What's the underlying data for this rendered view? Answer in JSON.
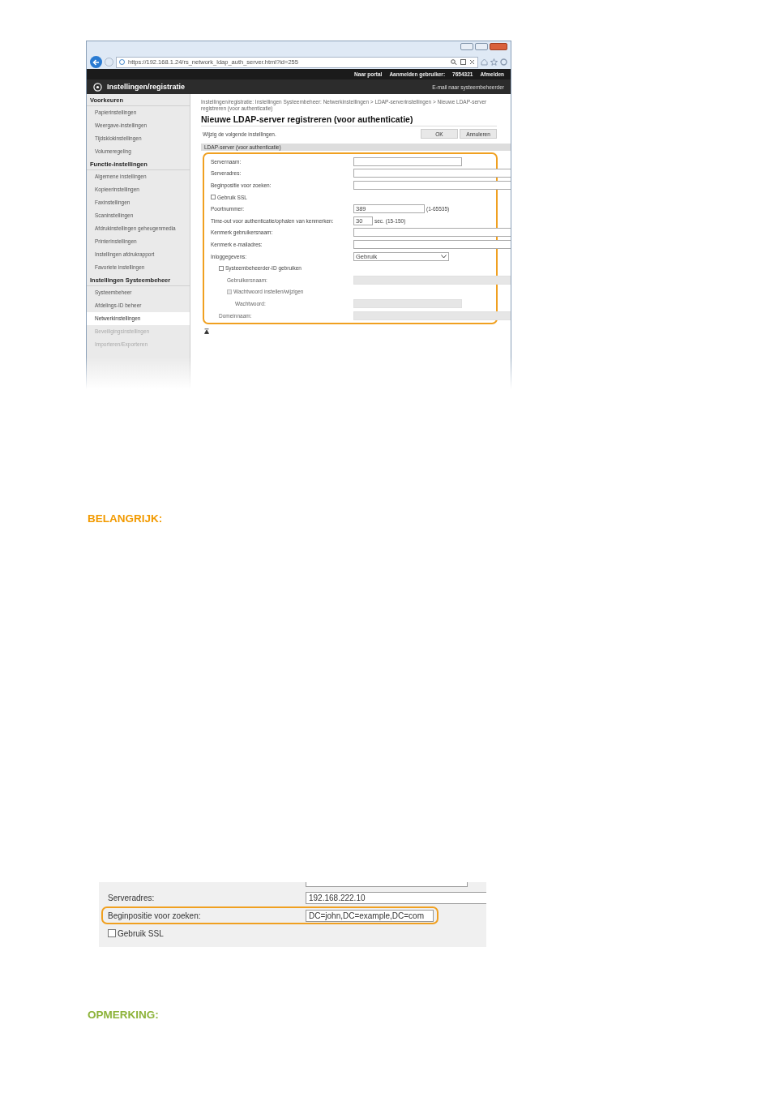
{
  "browser": {
    "url": "https://192.168.1.24/rs_network_ldap_auth_server.html?id=255"
  },
  "header": {
    "links": [
      "Naar portal",
      "Aanmelden gebruiker:",
      "7654321",
      "Afmelden"
    ],
    "app_title": "Instellingen/registratie",
    "mail_link": "E-mail naar systeembeheerder"
  },
  "sidebar": {
    "groups": [
      {
        "title": "Voorkeuren",
        "items": [
          {
            "label": "Papierinstellingen",
            "selected": false,
            "disabled": false
          },
          {
            "label": "Weergave-instellingen",
            "selected": false,
            "disabled": false
          },
          {
            "label": "Tijdsklokinstellingen",
            "selected": false,
            "disabled": false
          },
          {
            "label": "Volumeregeling",
            "selected": false,
            "disabled": false
          }
        ]
      },
      {
        "title": "Functie-instellingen",
        "items": [
          {
            "label": "Algemene instellingen",
            "selected": false,
            "disabled": false
          },
          {
            "label": "Kopieerinstellingen",
            "selected": false,
            "disabled": false
          },
          {
            "label": "Faxinstellingen",
            "selected": false,
            "disabled": false
          },
          {
            "label": "Scaninstellingen",
            "selected": false,
            "disabled": false
          },
          {
            "label": "Afdrukinstellingen geheugenmedia",
            "selected": false,
            "disabled": false
          },
          {
            "label": "Printerinstellingen",
            "selected": false,
            "disabled": false
          },
          {
            "label": "Instellingen afdrukrapport",
            "selected": false,
            "disabled": false
          },
          {
            "label": "Favoriete instellingen",
            "selected": false,
            "disabled": false
          }
        ]
      },
      {
        "title": "Instellingen Systeembeheer",
        "items": [
          {
            "label": "Systeembeheer",
            "selected": false,
            "disabled": false
          },
          {
            "label": "Afdelings-ID beheer",
            "selected": false,
            "disabled": false
          },
          {
            "label": "Netwerkinstellingen",
            "selected": true,
            "disabled": false
          },
          {
            "label": "Beveiligingsinstellingen",
            "selected": false,
            "disabled": true
          },
          {
            "label": "Importeren/Exporteren",
            "selected": false,
            "disabled": true
          }
        ]
      }
    ]
  },
  "main": {
    "breadcrumb": "Instellingen/registratie: Instellingen Systeembeheer: Netwerkinstellingen > LDAP-serverinstellingen > Nieuwe LDAP-server registreren (voor authenticatie)",
    "title": "Nieuwe LDAP-server registreren (voor authenticatie)",
    "intro": "Wijzig de volgende instellingen.",
    "buttons": [
      "OK",
      "Annuleren"
    ],
    "section_title": "LDAP-server (voor authenticatie)",
    "rows": [
      {
        "kind": "short-text",
        "label": "Servernaam:",
        "disabled": false
      },
      {
        "kind": "text",
        "label": "Serveradres:",
        "disabled": false
      },
      {
        "kind": "text",
        "label": "Beginpositie voor zoeken:",
        "disabled": false
      },
      {
        "kind": "checkbox",
        "label": "Gebruik SSL",
        "checked": false,
        "disabled": false
      },
      {
        "kind": "number",
        "label": "Poortnummer:",
        "value": "389",
        "hint": "(1-65535)",
        "disabled": false
      },
      {
        "kind": "tiny-number",
        "label": "Time-out voor authenticatie/ophalen van kenmerken:",
        "value": "30",
        "hint": "sec. (15-150)",
        "disabled": false
      },
      {
        "kind": "text",
        "label": "Kenmerk gebruikersnaam:",
        "disabled": false
      },
      {
        "kind": "text",
        "label": "Kenmerk e-mailadres:",
        "disabled": false
      },
      {
        "kind": "select",
        "label": "Inloggegevens:",
        "value": "Gebruik",
        "disabled": false,
        "children": [
          {
            "kind": "checkbox",
            "label": "Systeembeheerder-ID gebruiken",
            "checked": false,
            "disabled": false,
            "children": [
              {
                "kind": "text",
                "label": "Gebruikersnaam:",
                "disabled": true
              },
              {
                "kind": "checkbox",
                "label": "Wachtwoord instellen/wijzigen",
                "checked": false,
                "disabled": true,
                "children": [
                  {
                    "kind": "short-text",
                    "label": "Wachtwoord:",
                    "disabled": true
                  }
                ]
              }
            ]
          },
          {
            "kind": "text",
            "label": "Domeinnaam:",
            "disabled": true
          }
        ]
      }
    ]
  },
  "notes": [
    {
      "kind": "important",
      "title": "BELANGRIJK:"
    }
  ],
  "example": {
    "rows": [
      {
        "kind": "short-text",
        "highlighted": false
      },
      {
        "kind": "text",
        "label": "Serveradres:",
        "value": "192.168.222.10",
        "highlighted": false
      },
      {
        "kind": "text",
        "label": "Beginpositie voor zoeken:",
        "value": "DC=john,DC=example,DC=com",
        "highlighted": true
      },
      {
        "kind": "checkbox",
        "label": "Gebruik SSL",
        "checked": false,
        "highlighted": false
      }
    ]
  },
  "notes_after": [
    {
      "kind": "note",
      "title": "OPMERKING:"
    }
  ]
}
